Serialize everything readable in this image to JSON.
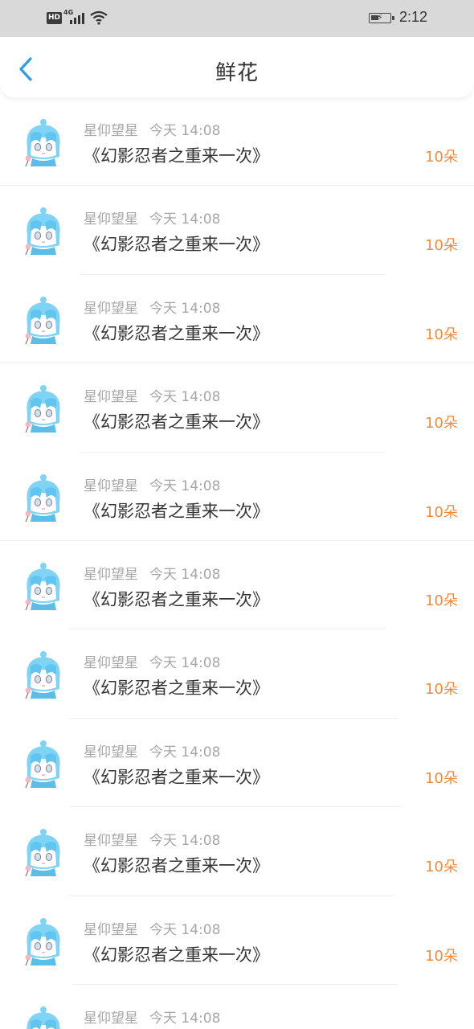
{
  "status_bar": {
    "hd": "HD",
    "network": "4G",
    "time": "2:12",
    "icons": [
      "signal-icon",
      "wifi-icon",
      "battery-charging-icon"
    ]
  },
  "header": {
    "title": "鲜花",
    "back_icon": "chevron-left-icon"
  },
  "colors": {
    "accent_blue": "#2a9fe8",
    "count_orange": "#f28a3c",
    "meta_gray": "#a6a6a6",
    "status_bar_bg": "#d9d9d9"
  },
  "items": [
    {
      "user": "星仰望星",
      "time": "今天 14:08",
      "book": "《幻影忍者之重来一次》",
      "count": "10朵"
    },
    {
      "user": "星仰望星",
      "time": "今天 14:08",
      "book": "《幻影忍者之重来一次》",
      "count": "10朵"
    },
    {
      "user": "星仰望星",
      "time": "今天 14:08",
      "book": "《幻影忍者之重来一次》",
      "count": "10朵"
    },
    {
      "user": "星仰望星",
      "time": "今天 14:08",
      "book": "《幻影忍者之重来一次》",
      "count": "10朵"
    },
    {
      "user": "星仰望星",
      "time": "今天 14:08",
      "book": "《幻影忍者之重来一次》",
      "count": "10朵"
    },
    {
      "user": "星仰望星",
      "time": "今天 14:08",
      "book": "《幻影忍者之重来一次》",
      "count": "10朵"
    },
    {
      "user": "星仰望星",
      "time": "今天 14:08",
      "book": "《幻影忍者之重来一次》",
      "count": "10朵"
    },
    {
      "user": "星仰望星",
      "time": "今天 14:08",
      "book": "《幻影忍者之重来一次》",
      "count": "10朵"
    },
    {
      "user": "星仰望星",
      "time": "今天 14:08",
      "book": "《幻影忍者之重来一次》",
      "count": "10朵"
    },
    {
      "user": "星仰望星",
      "time": "今天 14:08",
      "book": "《幻影忍者之重来一次》",
      "count": "10朵"
    },
    {
      "user": "星仰望星",
      "time": "今天 14:08",
      "book": "",
      "count": ""
    }
  ]
}
